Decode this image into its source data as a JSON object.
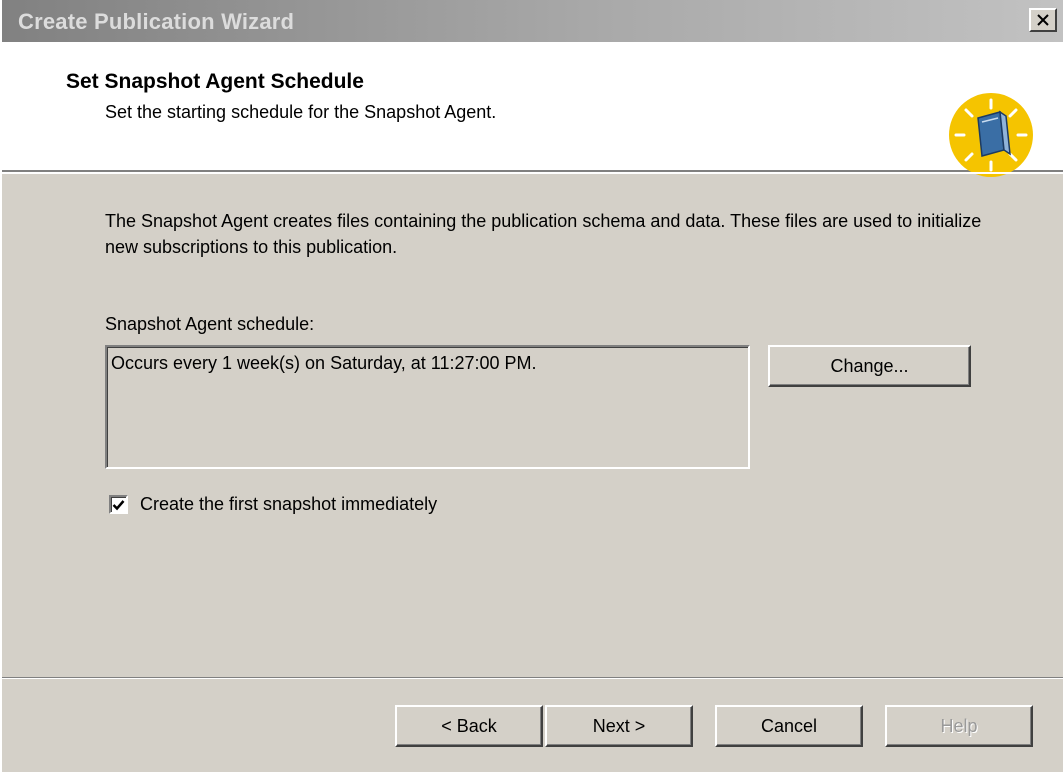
{
  "window": {
    "title": "Create Publication Wizard",
    "close_glyph": "×"
  },
  "header": {
    "title": "Set Snapshot Agent Schedule",
    "subtitle": "Set the starting schedule for the Snapshot Agent.",
    "icon": "book-sunburst-icon"
  },
  "main": {
    "description": "The Snapshot Agent creates files containing the publication schema and data. These files are used to initialize new subscriptions to this publication.",
    "schedule_label": "Snapshot Agent schedule:",
    "schedule_value": "Occurs every 1 week(s) on Saturday, at 11:27:00 PM.",
    "change_button": "Change...",
    "checkbox_label": "Create the first snapshot immediately",
    "checkbox_checked": true
  },
  "footer": {
    "back": "< Back",
    "next": "Next >",
    "cancel": "Cancel",
    "help": "Help"
  },
  "colors": {
    "face": "#d4d0c8",
    "icon_circle": "#f5c400",
    "icon_book": "#3a6ea5"
  }
}
